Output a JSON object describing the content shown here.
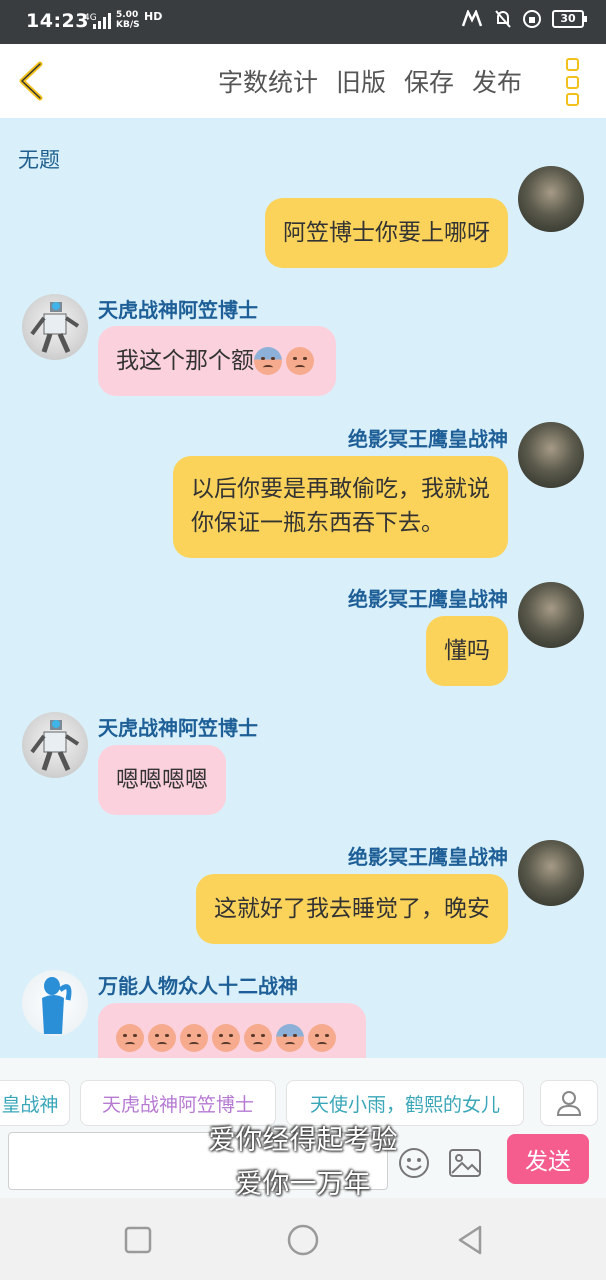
{
  "status_bar": {
    "time": "14:23",
    "network": "4G",
    "speed_top": "5.00",
    "speed_unit": "KB/S",
    "hd": "HD",
    "battery": "30"
  },
  "header": {
    "menu": [
      "字数统计",
      "旧版",
      "保存",
      "发布"
    ]
  },
  "chat": {
    "title": "无题",
    "messages": [
      {
        "side": "right",
        "name": "",
        "text": "阿笠博士你要上哪呀"
      },
      {
        "side": "left",
        "name": "天虎战神阿笠博士",
        "text": "我这个那个额"
      },
      {
        "side": "right",
        "name": "绝影冥王鹰皇战神",
        "text_lines": [
          "以后你要是再敢偷吃，我就说",
          "你保证一瓶东西吞下去。"
        ]
      },
      {
        "side": "right",
        "name": "绝影冥王鹰皇战神",
        "text": "懂吗"
      },
      {
        "side": "left",
        "name": "天虎战神阿笠博士",
        "text": "嗯嗯嗯嗯"
      },
      {
        "side": "right",
        "name": "绝影冥王鹰皇战神",
        "text": "这就好了我去睡觉了，晚安"
      },
      {
        "side": "left",
        "name": "万能人物众人十二战神",
        "text": ""
      }
    ]
  },
  "receivers": [
    "皇战神",
    "天虎战神阿笠博士",
    "天使小雨，鹤熙的女儿"
  ],
  "send_label": "发送",
  "captions": [
    "爱你经得起考验",
    "爱你一万年"
  ],
  "colors": {
    "my_bubble": "#fbd35b",
    "other_bubble": "#fbd1dd",
    "send": "#f55d8e",
    "accent": "#f2c11b"
  }
}
